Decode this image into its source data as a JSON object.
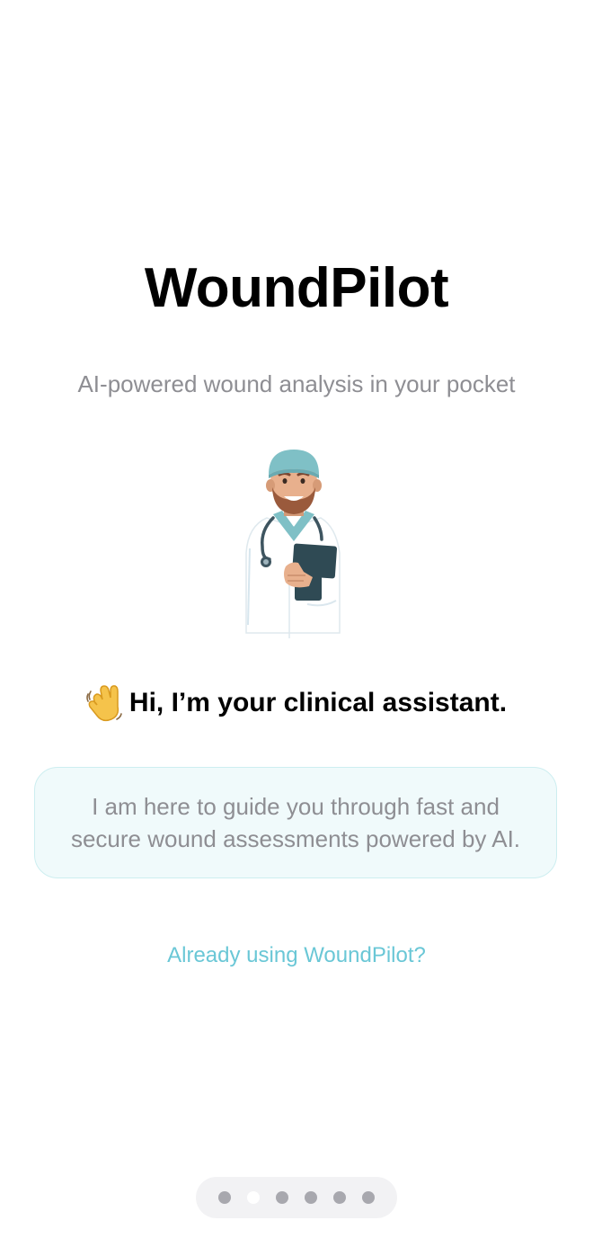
{
  "app": {
    "title": "WoundPilot",
    "subtitle": "AI-powered wound analysis in your pocket"
  },
  "illustration": {
    "icon": "doctor-illustration"
  },
  "greeting": {
    "icon": "waving-hand-icon",
    "text": "Hi, I’m your clinical assistant."
  },
  "info_card": {
    "text": "I am here to guide you through fast and secure wound assessments powered by AI."
  },
  "login_link": {
    "label": "Already using WoundPilot?"
  },
  "pager": {
    "total": 6,
    "current": 2
  },
  "colors": {
    "accent": "#6ac7d6",
    "card_background": "#f0fafb",
    "card_border": "#cdeef0",
    "muted_text": "#8e8e93"
  }
}
